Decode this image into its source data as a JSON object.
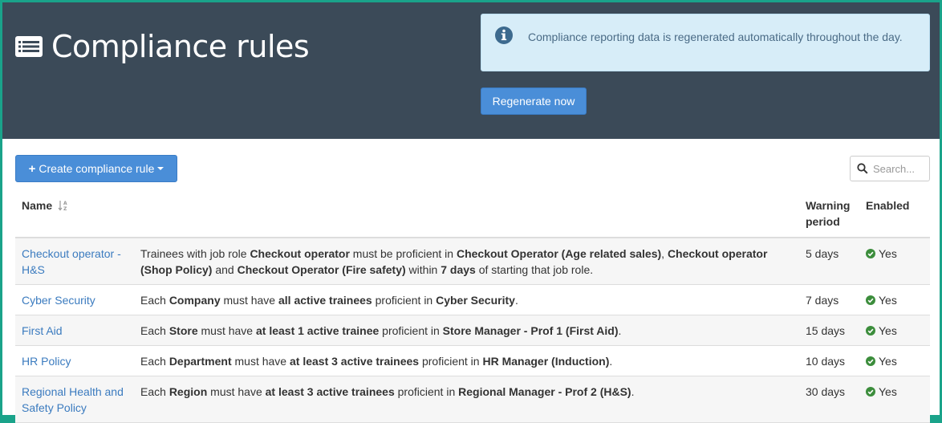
{
  "header": {
    "title": "Compliance rules",
    "title_icon": "list-alt-icon",
    "info_text": "Compliance reporting data is regenerated automatically throughout the day.",
    "regenerate_label": "Regenerate now"
  },
  "toolbar": {
    "create_label": "Create compliance rule",
    "search_placeholder": "Search..."
  },
  "table": {
    "headers": {
      "name": "Name",
      "description": "",
      "warning": [
        "Warning",
        "period"
      ],
      "enabled": "Enabled"
    },
    "rows": [
      {
        "name": "Checkout operator - H&S",
        "desc": [
          {
            "t": "Trainees with job role ",
            "b": false
          },
          {
            "t": "Checkout operator",
            "b": true
          },
          {
            "t": " must be proficient in ",
            "b": false
          },
          {
            "t": "Checkout Operator (Age related sales)",
            "b": true
          },
          {
            "t": ", ",
            "b": false
          },
          {
            "t": "Checkout operator (Shop Policy)",
            "b": true
          },
          {
            "t": " and ",
            "b": false
          },
          {
            "t": "Checkout Operator (Fire safety)",
            "b": true
          },
          {
            "t": " within ",
            "b": false
          },
          {
            "t": "7 days",
            "b": true
          },
          {
            "t": " of starting that job role.",
            "b": false
          }
        ],
        "warning": "5 days",
        "enabled": "Yes"
      },
      {
        "name": "Cyber Security",
        "desc": [
          {
            "t": "Each ",
            "b": false
          },
          {
            "t": "Company",
            "b": true
          },
          {
            "t": " must have ",
            "b": false
          },
          {
            "t": "all active trainees",
            "b": true
          },
          {
            "t": " proficient in ",
            "b": false
          },
          {
            "t": "Cyber Security",
            "b": true
          },
          {
            "t": ".",
            "b": false
          }
        ],
        "warning": "7 days",
        "enabled": "Yes"
      },
      {
        "name": "First Aid",
        "desc": [
          {
            "t": "Each ",
            "b": false
          },
          {
            "t": "Store",
            "b": true
          },
          {
            "t": " must have ",
            "b": false
          },
          {
            "t": "at least 1 active trainee",
            "b": true
          },
          {
            "t": " proficient in ",
            "b": false
          },
          {
            "t": "Store Manager - Prof 1 (First Aid)",
            "b": true
          },
          {
            "t": ".",
            "b": false
          }
        ],
        "warning": "15 days",
        "enabled": "Yes"
      },
      {
        "name": "HR Policy",
        "desc": [
          {
            "t": "Each ",
            "b": false
          },
          {
            "t": "Department",
            "b": true
          },
          {
            "t": " must have ",
            "b": false
          },
          {
            "t": "at least 3 active trainees",
            "b": true
          },
          {
            "t": " proficient in ",
            "b": false
          },
          {
            "t": "HR Manager (Induction)",
            "b": true
          },
          {
            "t": ".",
            "b": false
          }
        ],
        "warning": "10 days",
        "enabled": "Yes"
      },
      {
        "name": "Regional Health and Safety Policy",
        "desc": [
          {
            "t": "Each ",
            "b": false
          },
          {
            "t": "Region",
            "b": true
          },
          {
            "t": " must have ",
            "b": false
          },
          {
            "t": "at least 3 active trainees",
            "b": true
          },
          {
            "t": " proficient in ",
            "b": false
          },
          {
            "t": "Regional Manager - Prof 2 (H&S)",
            "b": true
          },
          {
            "t": ".",
            "b": false
          }
        ],
        "warning": "30 days",
        "enabled": "Yes"
      }
    ]
  },
  "colors": {
    "header_bg": "#3b4a58",
    "primary": "#4a8ed8",
    "info_bg": "#d7edf8",
    "link": "#3b7bbf",
    "success": "#3c8d3c",
    "frame": "#1aa38a"
  }
}
